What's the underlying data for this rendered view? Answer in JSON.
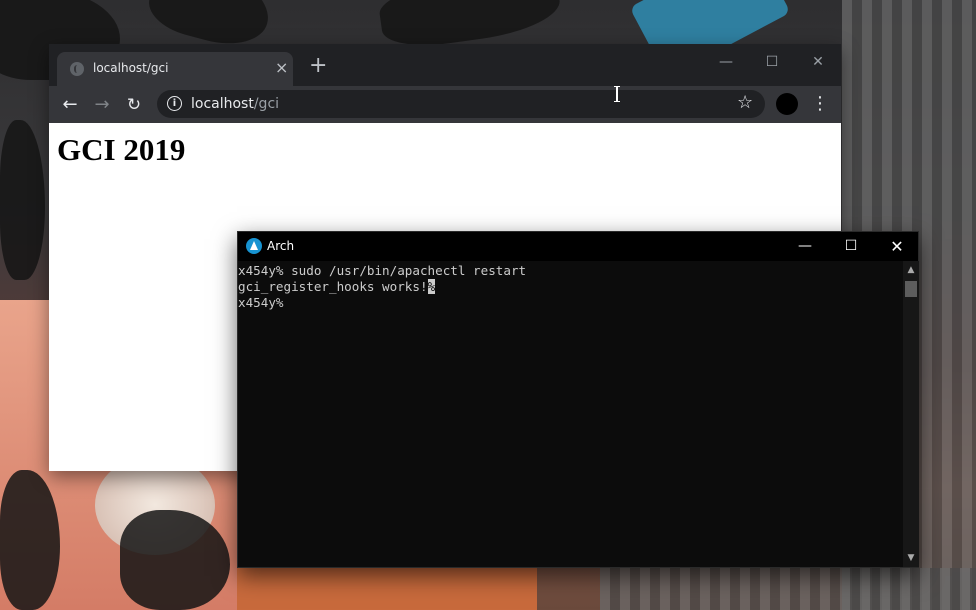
{
  "browser": {
    "tab_title": "localhost/gci",
    "tab_close": "×",
    "new_tab": "+",
    "window_controls": {
      "minimize": "—",
      "maximize": "☐",
      "close": "✕"
    },
    "nav": {
      "back": "←",
      "forward": "→",
      "reload": "↻"
    },
    "url_host": "localhost",
    "url_path": "/gci",
    "info_icon": "i",
    "bookmark_icon": "☆",
    "menu_icon": "⋮",
    "page_heading": "GCI 2019"
  },
  "terminal": {
    "title": "Arch",
    "window_controls": {
      "minimize": "—",
      "maximize": "☐",
      "close": "✕"
    },
    "lines": [
      "x454y% sudo /usr/bin/apachectl restart",
      "gci_register_hooks works!",
      "x454y%"
    ],
    "highlighted_char": "%",
    "scroll_up": "▲",
    "scroll_down": "▼"
  },
  "colors": {
    "browser_chrome": "#202124",
    "browser_toolbar": "#35363a",
    "terminal_bg": "#0c0c0c",
    "terminal_text": "#cccccc",
    "arch_blue": "#1793d1"
  }
}
